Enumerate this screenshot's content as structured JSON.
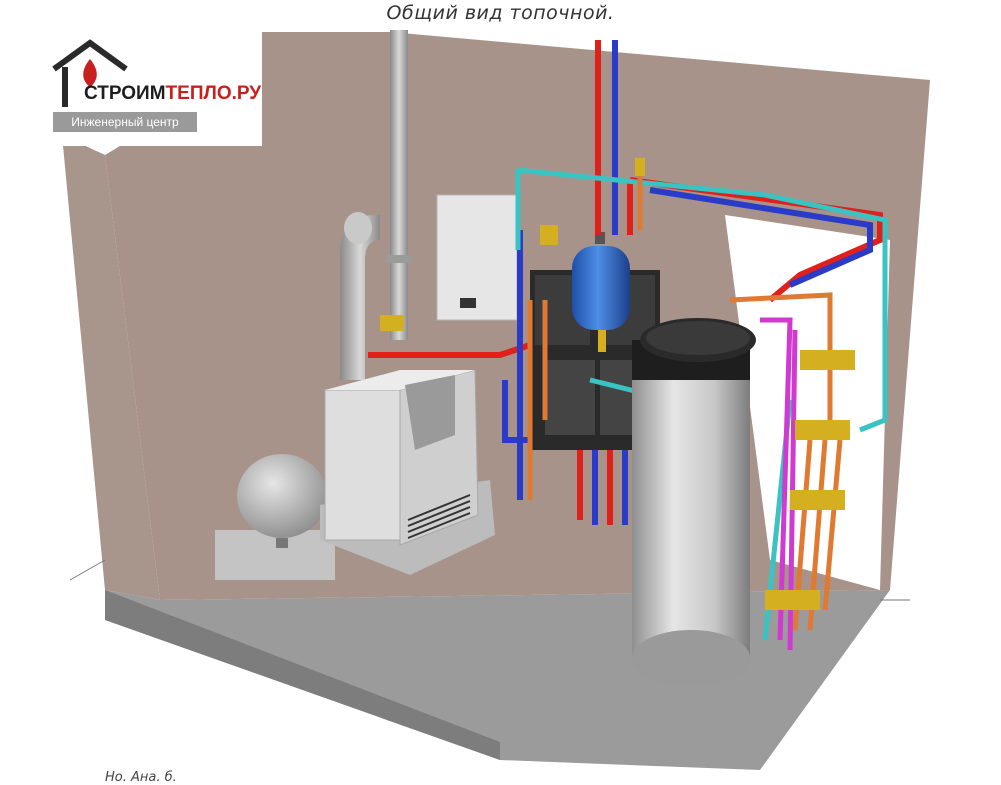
{
  "caption": "Общий вид топочной.",
  "logo": {
    "name_part1": "СТРОИМ",
    "name_part2": "ТЕПЛО.РУ",
    "subtitle": "Инженерный центр"
  },
  "footer": "Но. Ана. б.",
  "colors": {
    "wall": "#a7938a",
    "floor": "#9a9a9a",
    "hot_pipe": "#e0201a",
    "cold_pipe": "#2a3bc8",
    "recirc_pipe": "#3ac3c3",
    "copper_pipe": "#e07a30",
    "magenta_pipe": "#d03ad0",
    "expansion_tank": "#2e6fd1"
  }
}
